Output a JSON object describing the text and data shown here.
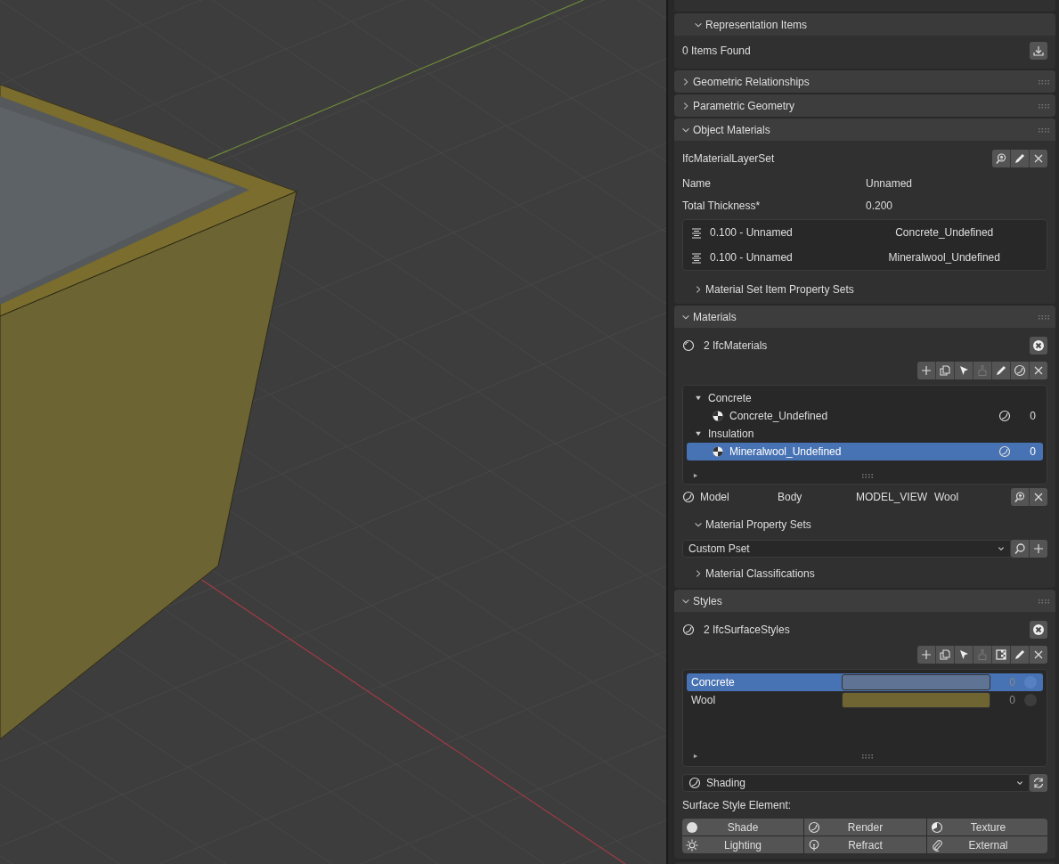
{
  "representation_items": {
    "title": "Representation Items",
    "expanded": true,
    "status": "0 Items Found"
  },
  "geometric_relationships": {
    "title": "Geometric Relationships",
    "expanded": false
  },
  "parametric_geometry": {
    "title": "Parametric Geometry",
    "expanded": false
  },
  "object_materials": {
    "title": "Object Materials",
    "expanded": true,
    "set_type": "IfcMaterialLayerSet",
    "fields": [
      {
        "label": "Name",
        "value": "Unnamed"
      },
      {
        "label": "Total Thickness*",
        "value": "0.200"
      }
    ],
    "layers": [
      {
        "layer": "0.100 - Unnamed",
        "material": "Concrete_Undefined"
      },
      {
        "layer": "0.100 - Unnamed",
        "material": "Mineralwool_Undefined"
      }
    ],
    "item_property_sets": {
      "title": "Material Set Item Property Sets",
      "expanded": false
    }
  },
  "materials": {
    "title": "Materials",
    "expanded": true,
    "count": "2 IfcMaterials",
    "tree": [
      {
        "label": "Concrete",
        "expanded": true,
        "selected": false,
        "children": [
          {
            "label": "Concrete_Undefined",
            "styles": "0",
            "selected": false
          }
        ]
      },
      {
        "label": "Insulation",
        "expanded": true,
        "selected": false,
        "children": [
          {
            "label": "Mineralwool_Undefined",
            "styles": "0",
            "selected": true
          }
        ]
      }
    ],
    "representation": {
      "context": "Model",
      "subcontext": "Body",
      "target_view": "MODEL_VIEW",
      "style": "Wool"
    },
    "property_sets": {
      "title": "Material Property Sets",
      "expanded": true,
      "pset": "Custom Pset"
    },
    "classifications": {
      "title": "Material Classifications",
      "expanded": false
    }
  },
  "styles": {
    "title": "Styles",
    "expanded": true,
    "count": "2 IfcSurfaceStyles",
    "items": [
      {
        "name": "Concrete",
        "color": "#5f7394",
        "count": "0",
        "selected": true
      },
      {
        "name": "Wool",
        "color": "#6f6532",
        "count": "0",
        "selected": false
      }
    ],
    "element_type": "Shading",
    "element_label": "Surface Style Element:",
    "element_buttons": [
      {
        "kind": "shade",
        "label": "Shade"
      },
      {
        "kind": "render",
        "label": "Render"
      },
      {
        "kind": "texture",
        "label": "Texture"
      },
      {
        "kind": "lighting",
        "label": "Lighting"
      },
      {
        "kind": "refract",
        "label": "Refract"
      },
      {
        "kind": "external",
        "label": "External"
      }
    ]
  }
}
